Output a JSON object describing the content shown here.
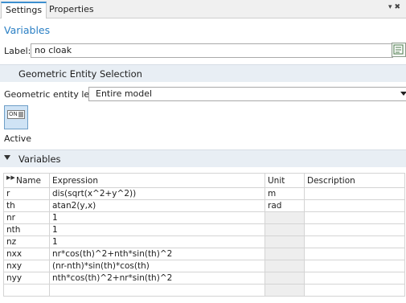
{
  "tabs": [
    {
      "label": "Settings"
    },
    {
      "label": "Properties"
    }
  ],
  "heading": "Variables",
  "label_field": {
    "label": "Label:",
    "value": "no cloak"
  },
  "sections": {
    "geom": "Geometric Entity Selection",
    "variables": "Variables"
  },
  "geom_level": {
    "label": "Geometric entity level:",
    "value": "Entire model"
  },
  "toggle": {
    "text": "ON",
    "label": "Active",
    "state": "on"
  },
  "table": {
    "headers": [
      "Name",
      "Expression",
      "Unit",
      "Description"
    ],
    "rows": [
      {
        "name": "r",
        "expr": "dis(sqrt(x^2+y^2))",
        "unit": "m",
        "desc": ""
      },
      {
        "name": "th",
        "expr": "atan2(y,x)",
        "unit": "rad",
        "desc": ""
      },
      {
        "name": "nr",
        "expr": "1",
        "unit": "",
        "desc": ""
      },
      {
        "name": "nth",
        "expr": "1",
        "unit": "",
        "desc": ""
      },
      {
        "name": "nz",
        "expr": "1",
        "unit": "",
        "desc": ""
      },
      {
        "name": "nxx",
        "expr": "nr*cos(th)^2+nth*sin(th)^2",
        "unit": "",
        "desc": ""
      },
      {
        "name": "nxy",
        "expr": "(nr-nth)*sin(th)*cos(th)",
        "unit": "",
        "desc": ""
      },
      {
        "name": "nyy",
        "expr": "nth*cos(th)^2+nr*sin(th)^2",
        "unit": "",
        "desc": ""
      },
      {
        "name": "",
        "expr": "",
        "unit": "",
        "desc": ""
      }
    ]
  }
}
